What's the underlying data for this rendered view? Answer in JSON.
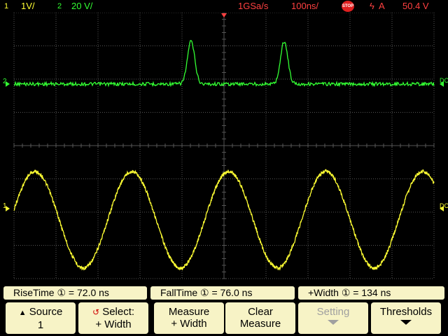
{
  "status": {
    "ch1_number": "1",
    "ch1_scale": "1V/",
    "ch2_number": "2",
    "ch2_scale": "20 V/",
    "sample_rate": "1GSa/s",
    "time_scale": "100ns/",
    "run_state": "STOP",
    "trigger_icon": "trigger-edge-icon",
    "trigger_source": "A",
    "trigger_level": "50.4 V"
  },
  "screen": {
    "ch1_marker": "1",
    "ch2_marker": "2",
    "ch1_right_marker": "DC",
    "ch2_right_marker": "DC",
    "colors": {
      "ch1": "#ffff33",
      "ch2": "#33ff33",
      "grid": "#555555",
      "trigger": "#ff4040"
    }
  },
  "measurements": {
    "rise": "RiseTime ① =  72.0 ns",
    "fall": "FallTime ① =  76.0 ns",
    "width": "+Width ① = 134 ns"
  },
  "softkeys": {
    "source_label": "Source",
    "source_value": "1",
    "select_label": "Select:",
    "select_value": "+ Width",
    "measure_label": "Measure",
    "measure_value": "+ Width",
    "clear_label": "Clear",
    "clear_value": "Measure",
    "setting_label": "Setting",
    "thresholds_label": "Thresholds"
  }
}
